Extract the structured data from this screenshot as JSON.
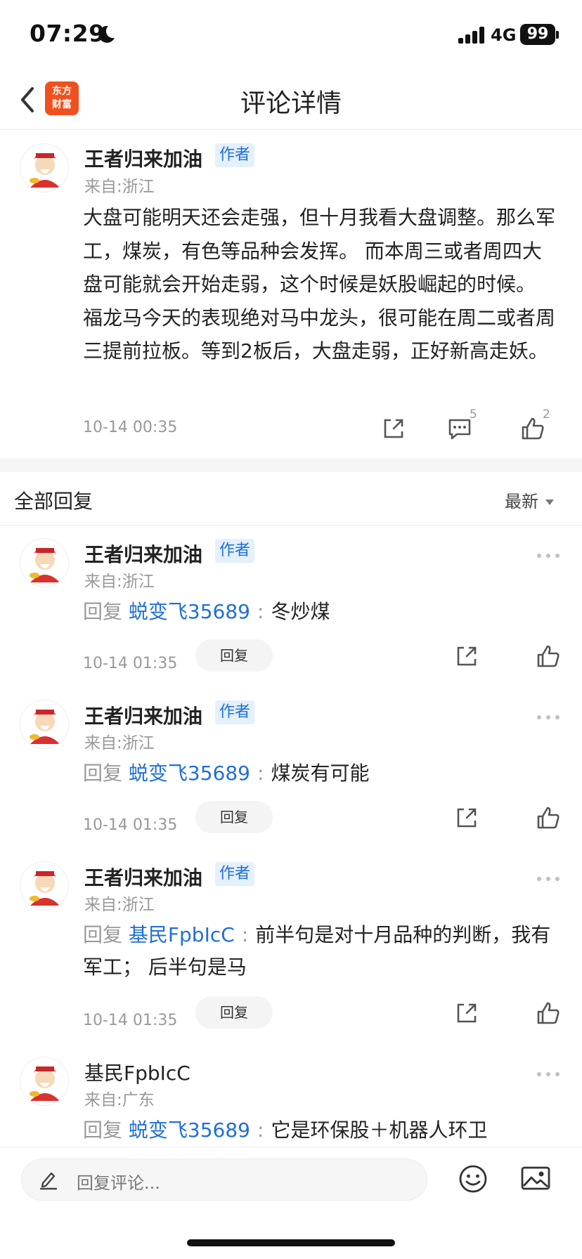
{
  "status_bar": {
    "time": "07:29",
    "network": "4G",
    "battery": "99"
  },
  "nav": {
    "title": "评论详情",
    "brand_line1": "东方",
    "brand_line2": "财富"
  },
  "main_comment": {
    "username": "王者归来加油",
    "badge": "作者",
    "location": "来自:浙江",
    "text": "大盘可能明天还会走强，但十月我看大盘调整。那么军工，煤炭，有色等品种会发挥。 而本周三或者周四大盘可能就会开始走弱，这个时候是妖股崛起的时候。 福龙马今天的表现绝对马中龙头，很可能在周二或者周三提前拉板。等到2板后，大盘走弱，正好新高走妖。",
    "timestamp": "10-14 00:35",
    "comment_count": "5",
    "like_count": "2"
  },
  "replies_header": {
    "title": "全部回复",
    "sort": "最新"
  },
  "replies": [
    {
      "username": "王者归来加油",
      "badge": "作者",
      "location": "来自:浙江",
      "prefix": "回复",
      "target": "蜕变飞35689",
      "text": "冬炒煤",
      "timestamp": "10-14 01:35",
      "reply_label": "回复"
    },
    {
      "username": "王者归来加油",
      "badge": "作者",
      "location": "来自:浙江",
      "prefix": "回复",
      "target": "蜕变飞35689",
      "text": "煤炭有可能",
      "timestamp": "10-14 01:35",
      "reply_label": "回复"
    },
    {
      "username": "王者归来加油",
      "badge": "作者",
      "location": "来自:浙江",
      "prefix": "回复",
      "target": "基民FpbIcC",
      "text": "前半句是对十月品种的判断，我有军工； 后半句是马",
      "timestamp": "10-14 01:35",
      "reply_label": "回复"
    },
    {
      "username": "基民FpbIcC",
      "badge": "",
      "location": "来自:广东",
      "prefix": "回复",
      "target": "蜕变飞35689",
      "text": "它是环保股＋机器人环卫",
      "timestamp": "",
      "reply_label": ""
    }
  ],
  "bottom_bar": {
    "placeholder": "回复评论..."
  }
}
